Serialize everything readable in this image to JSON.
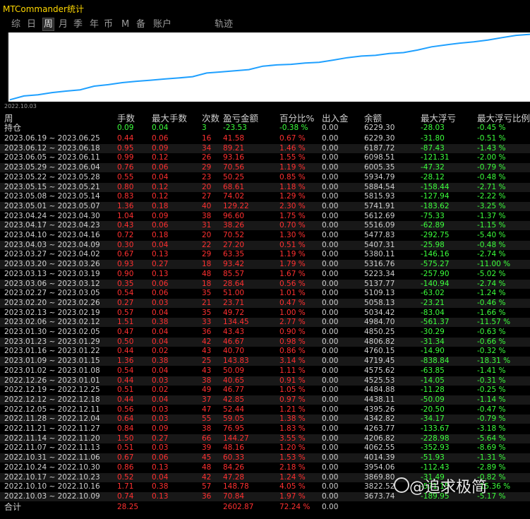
{
  "window": {
    "title": "MTCommander统计"
  },
  "tabs": [
    {
      "label": "综",
      "active": false
    },
    {
      "label": "日",
      "active": false
    },
    {
      "label": "周",
      "active": true
    },
    {
      "label": "月",
      "active": false
    },
    {
      "label": "季",
      "active": false
    },
    {
      "label": "年",
      "active": false
    },
    {
      "label": "币",
      "active": false
    },
    {
      "label": "M",
      "active": false
    },
    {
      "label": "备",
      "active": false
    },
    {
      "label": "账户",
      "active": false
    },
    {
      "label": "轨迹",
      "active": false
    }
  ],
  "chart_data": {
    "type": "line",
    "x_start_label": "2022.10.03",
    "series": [
      {
        "color": "#1fa0ff",
        "values": [
          3673.74,
          3822.52,
          3869.8,
          3954.06,
          4014.39,
          4062.55,
          4206.82,
          4263.77,
          4342.82,
          4395.26,
          4438.11,
          4484.88,
          4525.53,
          4575.62,
          4719.45,
          4760.15,
          4806.82,
          4850.25,
          4984.7,
          5034.42,
          5058.13,
          5109.13,
          5137.77,
          5223.34,
          5316.76,
          5380.11,
          5407.31,
          5477.83,
          5516.09,
          5612.69,
          5741.91,
          5815.93,
          5884.54,
          5934.79,
          6005.35,
          6098.51,
          6187.72,
          6229.3
        ]
      }
    ],
    "ylim": [
      3600,
      6300
    ],
    "grid": false,
    "colors": {
      "line": "#1fa0ff",
      "axis": "#9a9a9a",
      "background": "#ffffff"
    }
  },
  "table": {
    "headers": [
      "周",
      "手数",
      "最大手数",
      "次数",
      "盈亏金额",
      "百分比%",
      "出入金",
      "余额",
      "最大浮亏",
      "最大浮亏比例"
    ],
    "position_row": {
      "label": "持仓",
      "lots": "0.09",
      "max_lots": "0.04",
      "count": "3",
      "pnl": "-23.53",
      "pct": "-0.38 %",
      "flow": "0.00",
      "balance": "6229.30",
      "max_float": "-28.03",
      "max_float_pct": "-0.45 %"
    },
    "rows": [
      [
        "2023.06.19 ~ 2023.06.25",
        "0.44",
        "0.06",
        "16",
        "41.58",
        "0.67 %",
        "0.00",
        "6229.30",
        "-31.80",
        "-0.51 %"
      ],
      [
        "2023.06.12 ~ 2023.06.18",
        "0.95",
        "0.09",
        "34",
        "89.21",
        "1.46 %",
        "0.00",
        "6187.72",
        "-87.43",
        "-1.43 %"
      ],
      [
        "2023.06.05 ~ 2023.06.11",
        "0.99",
        "0.12",
        "26",
        "93.16",
        "1.55 %",
        "0.00",
        "6098.51",
        "-121.31",
        "-2.00 %"
      ],
      [
        "2023.05.29 ~ 2023.06.04",
        "0.76",
        "0.06",
        "29",
        "70.56",
        "1.19 %",
        "0.00",
        "6005.35",
        "-47.32",
        "-0.79 %"
      ],
      [
        "2023.05.22 ~ 2023.05.28",
        "0.55",
        "0.04",
        "23",
        "50.25",
        "0.85 %",
        "0.00",
        "5934.79",
        "-28.12",
        "-0.48 %"
      ],
      [
        "2023.05.15 ~ 2023.05.21",
        "0.80",
        "0.12",
        "20",
        "68.61",
        "1.18 %",
        "0.00",
        "5884.54",
        "-158.44",
        "-2.71 %"
      ],
      [
        "2023.05.08 ~ 2023.05.14",
        "0.83",
        "0.12",
        "27",
        "74.02",
        "1.29 %",
        "0.00",
        "5815.93",
        "-127.94",
        "-2.22 %"
      ],
      [
        "2023.05.01 ~ 2023.05.07",
        "1.36",
        "0.18",
        "40",
        "129.22",
        "2.30 %",
        "0.00",
        "5741.91",
        "-183.62",
        "-3.25 %"
      ],
      [
        "2023.04.24 ~ 2023.04.30",
        "1.04",
        "0.09",
        "38",
        "96.60",
        "1.75 %",
        "0.00",
        "5612.69",
        "-75.33",
        "-1.37 %"
      ],
      [
        "2023.04.17 ~ 2023.04.23",
        "0.43",
        "0.06",
        "31",
        "38.26",
        "0.70 %",
        "0.00",
        "5516.09",
        "-62.89",
        "-1.15 %"
      ],
      [
        "2023.04.10 ~ 2023.04.16",
        "0.72",
        "0.18",
        "20",
        "70.52",
        "1.30 %",
        "0.00",
        "5477.83",
        "-292.75",
        "-5.40 %"
      ],
      [
        "2023.04.03 ~ 2023.04.09",
        "0.30",
        "0.04",
        "22",
        "27.20",
        "0.51 %",
        "0.00",
        "5407.31",
        "-25.98",
        "-0.48 %"
      ],
      [
        "2023.03.27 ~ 2023.04.02",
        "0.67",
        "0.13",
        "29",
        "63.35",
        "1.19 %",
        "0.00",
        "5380.11",
        "-146.16",
        "-2.74 %"
      ],
      [
        "2023.03.20 ~ 2023.03.26",
        "0.93",
        "0.27",
        "18",
        "93.42",
        "1.79 %",
        "0.00",
        "5316.76",
        "-575.27",
        "-11.00 %"
      ],
      [
        "2023.03.13 ~ 2023.03.19",
        "0.90",
        "0.13",
        "48",
        "85.57",
        "1.67 %",
        "0.00",
        "5223.34",
        "-257.90",
        "-5.02 %"
      ],
      [
        "2023.03.06 ~ 2023.03.12",
        "0.35",
        "0.06",
        "18",
        "28.64",
        "0.56 %",
        "0.00",
        "5137.77",
        "-140.94",
        "-2.74 %"
      ],
      [
        "2023.02.27 ~ 2023.03.05",
        "0.54",
        "0.06",
        "35",
        "51.00",
        "1.01 %",
        "0.00",
        "5109.13",
        "-63.02",
        "-1.24 %"
      ],
      [
        "2023.02.20 ~ 2023.02.26",
        "0.27",
        "0.03",
        "21",
        "23.71",
        "0.47 %",
        "0.00",
        "5058.13",
        "-23.21",
        "-0.46 %"
      ],
      [
        "2023.02.13 ~ 2023.02.19",
        "0.57",
        "0.04",
        "35",
        "49.72",
        "1.00 %",
        "0.00",
        "5034.42",
        "-83.04",
        "-1.66 %"
      ],
      [
        "2023.02.06 ~ 2023.02.12",
        "1.51",
        "0.38",
        "33",
        "134.45",
        "2.77 %",
        "0.00",
        "4984.70",
        "-561.37",
        "-11.57 %"
      ],
      [
        "2023.01.30 ~ 2023.02.05",
        "0.47",
        "0.04",
        "36",
        "43.43",
        "0.90 %",
        "0.00",
        "4850.25",
        "-30.29",
        "-0.63 %"
      ],
      [
        "2023.01.23 ~ 2023.01.29",
        "0.50",
        "0.04",
        "42",
        "46.67",
        "0.98 %",
        "0.00",
        "4806.82",
        "-31.34",
        "-0.66 %"
      ],
      [
        "2023.01.16 ~ 2023.01.22",
        "0.44",
        "0.02",
        "43",
        "40.70",
        "0.86 %",
        "0.00",
        "4760.15",
        "-14.90",
        "-0.32 %"
      ],
      [
        "2023.01.09 ~ 2023.01.15",
        "1.36",
        "0.38",
        "25",
        "143.83",
        "3.14 %",
        "0.00",
        "4719.45",
        "-838.84",
        "-18.31 %"
      ],
      [
        "2023.01.02 ~ 2023.01.08",
        "0.54",
        "0.04",
        "43",
        "50.09",
        "1.11 %",
        "0.00",
        "4575.62",
        "-63.85",
        "-1.41 %"
      ],
      [
        "2022.12.26 ~ 2023.01.01",
        "0.44",
        "0.03",
        "38",
        "40.65",
        "0.91 %",
        "0.00",
        "4525.53",
        "-14.05",
        "-0.31 %"
      ],
      [
        "2022.12.19 ~ 2022.12.25",
        "0.51",
        "0.02",
        "49",
        "46.77",
        "1.05 %",
        "0.00",
        "4484.88",
        "-11.28",
        "-0.25 %"
      ],
      [
        "2022.12.12 ~ 2022.12.18",
        "0.44",
        "0.04",
        "37",
        "42.85",
        "0.97 %",
        "0.00",
        "4438.11",
        "-50.09",
        "-1.14 %"
      ],
      [
        "2022.12.05 ~ 2022.12.11",
        "0.56",
        "0.03",
        "47",
        "52.44",
        "1.21 %",
        "0.00",
        "4395.26",
        "-20.50",
        "-0.47 %"
      ],
      [
        "2022.11.28 ~ 2022.12.04",
        "0.64",
        "0.03",
        "55",
        "59.05",
        "1.38 %",
        "0.00",
        "4342.82",
        "-34.17",
        "-0.79 %"
      ],
      [
        "2022.11.21 ~ 2022.11.27",
        "0.84",
        "0.09",
        "38",
        "76.95",
        "1.83 %",
        "0.00",
        "4263.77",
        "-133.67",
        "-3.18 %"
      ],
      [
        "2022.11.14 ~ 2022.11.20",
        "1.50",
        "0.27",
        "66",
        "144.27",
        "3.55 %",
        "0.00",
        "4206.82",
        "-228.98",
        "-5.64 %"
      ],
      [
        "2022.11.07 ~ 2022.11.13",
        "0.51",
        "0.03",
        "39",
        "48.16",
        "1.20 %",
        "0.00",
        "4062.55",
        "-352.93",
        "-8.69 %"
      ],
      [
        "2022.10.31 ~ 2022.11.06",
        "0.67",
        "0.06",
        "45",
        "60.33",
        "1.53 %",
        "0.00",
        "4014.39",
        "-51.93",
        "-1.31 %"
      ],
      [
        "2022.10.24 ~ 2022.10.30",
        "0.86",
        "0.13",
        "48",
        "84.26",
        "2.18 %",
        "0.00",
        "3954.06",
        "-112.43",
        "-2.89 %"
      ],
      [
        "2022.10.17 ~ 2022.10.23",
        "0.52",
        "0.04",
        "42",
        "47.28",
        "1.24 %",
        "0.00",
        "3869.80",
        "-31.49",
        "-0.82 %"
      ],
      [
        "2022.10.10 ~ 2022.10.16",
        "1.71",
        "0.38",
        "57",
        "148.78",
        "4.05 %",
        "0.00",
        "3822.52",
        "-571.15",
        "-15.36 %"
      ],
      [
        "2022.10.03 ~ 2022.10.09",
        "0.74",
        "0.13",
        "36",
        "70.84",
        "1.97 %",
        "0.00",
        "3673.74",
        "-189.95",
        "-5.17 %"
      ]
    ],
    "total_row": {
      "label": "合计",
      "lots": "28.25",
      "pnl": "2602.87",
      "pct": "72.24 %",
      "flow": "0.00"
    }
  },
  "watermark": {
    "text": "@追求极简"
  }
}
